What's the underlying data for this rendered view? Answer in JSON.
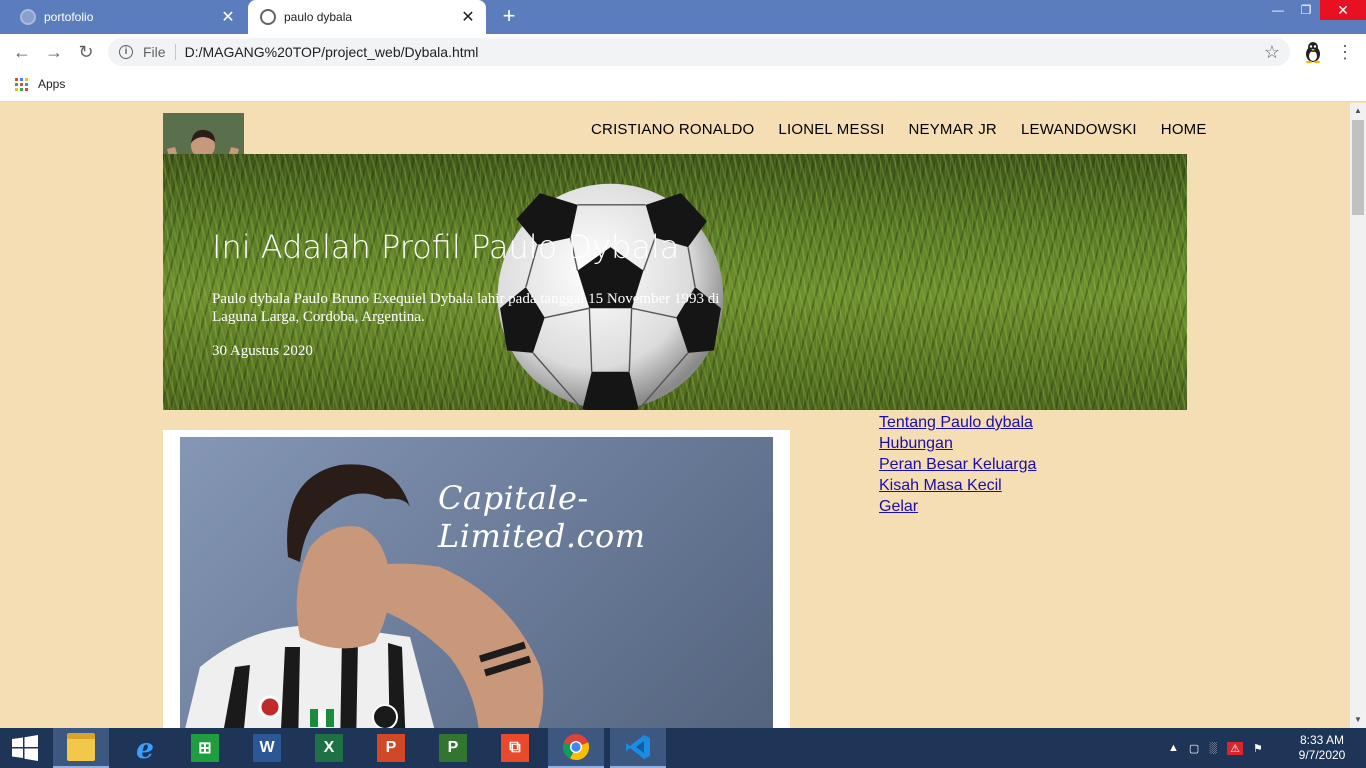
{
  "browser": {
    "tabs": [
      {
        "title": "portofolio",
        "active": false
      },
      {
        "title": "paulo dybala",
        "active": true
      }
    ],
    "address": {
      "scheme_label": "File",
      "url": "D:/MAGANG%20TOP/project_web/Dybala.html"
    },
    "bookmarks": {
      "apps_label": "Apps"
    }
  },
  "page": {
    "nav": [
      "CRISTIANO RONALDO",
      "LIONEL MESSI",
      "NEYMAR JR",
      "LEWANDOWSKI",
      "HOME"
    ],
    "hero": {
      "title": "Ini Adalah Profil Paulo Dybala",
      "description": "Paulo dybala Paulo Bruno Exequiel Dybala lahir pada tanggal 15 November 1993 di Laguna Larga, Cordoba, Argentina.",
      "date": "30 Agustus 2020"
    },
    "photo": {
      "watermark": "Capitale-Limited.com"
    },
    "side_links": [
      "Tentang Paulo dybala",
      "Hubungan",
      "Peran Besar Keluarga",
      "Kisah Masa Kecil",
      "Gelar"
    ]
  },
  "taskbar": {
    "apps": [
      "File Explorer",
      "Internet Explorer",
      "Store",
      "Word",
      "Excel",
      "PowerPoint",
      "Project",
      "Office",
      "Chrome",
      "VS Code"
    ],
    "clock": {
      "time": "8:33 AM",
      "date": "9/7/2020"
    }
  },
  "colors": {
    "titlebar": "#5b7dbd",
    "page_background": "#f5deb3",
    "link": "#1a0dab",
    "taskbar": "#1f3558"
  }
}
